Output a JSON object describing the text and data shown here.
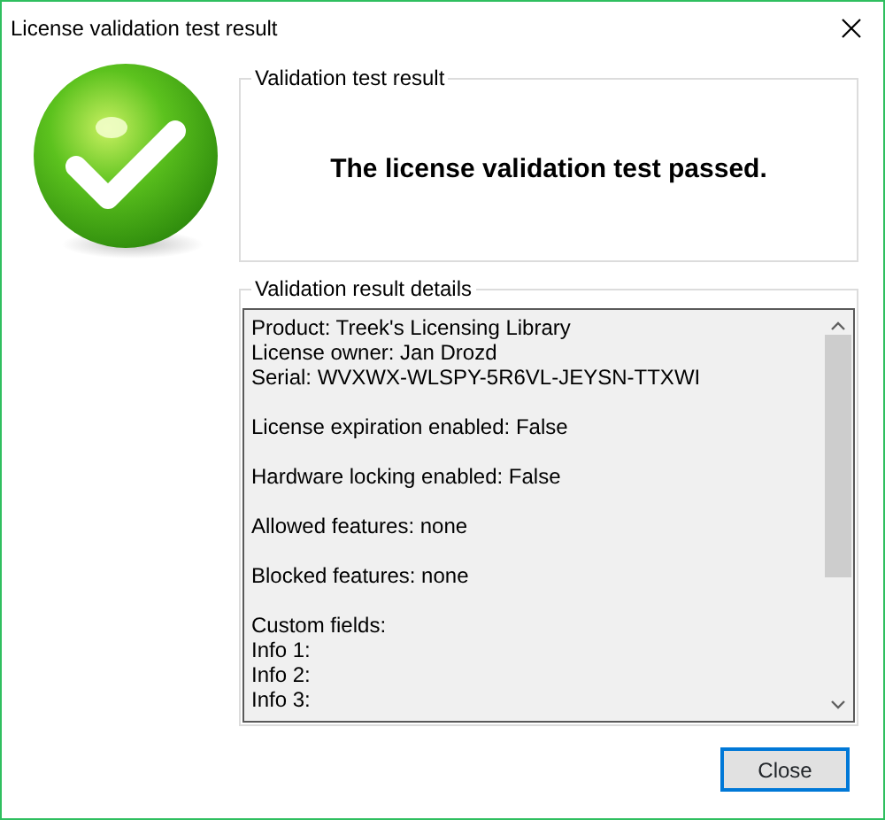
{
  "window": {
    "title": "License validation test result"
  },
  "result_group": {
    "legend": "Validation test result",
    "message": "The license validation test passed.",
    "passed": true
  },
  "details_group": {
    "legend": "Validation result details",
    "sections": [
      [
        "Product: Treek's Licensing Library",
        "License owner: Jan Drozd",
        "Serial: WVXWX-WLSPY-5R6VL-JEYSN-TTXWI"
      ],
      [
        "License expiration enabled: False"
      ],
      [
        "Hardware locking enabled: False"
      ],
      [
        "Allowed features: none"
      ],
      [
        "Blocked features: none"
      ],
      [
        "Custom fields:",
        "Info 1:",
        "Info 2:",
        "Info 3:"
      ]
    ]
  },
  "buttons": [
    {
      "label": "Close",
      "default": true
    }
  ]
}
